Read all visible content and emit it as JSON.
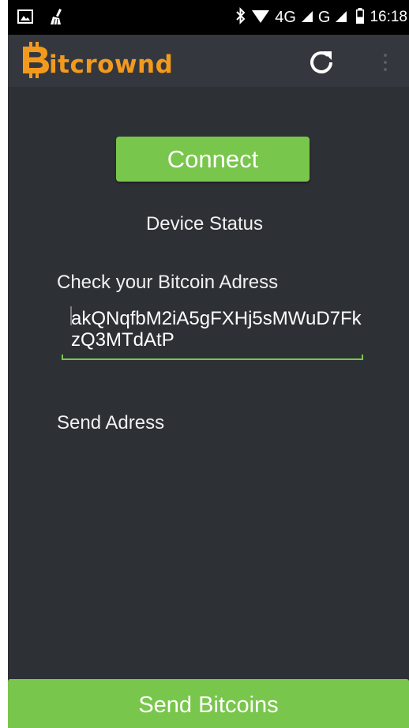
{
  "status_bar": {
    "network_4g": "4G",
    "network_g": "G",
    "time": "16:18",
    "icons": [
      "gallery-icon",
      "cleaner-icon",
      "bluetooth-icon",
      "wifi-icon",
      "signal-icon",
      "battery-icon"
    ]
  },
  "app_bar": {
    "logo_letter": "B",
    "logo_text": "itcrownd",
    "logo_color": "#f29a1e",
    "refresh_icon": "refresh-icon",
    "overflow_icon": "overflow-menu-icon"
  },
  "main": {
    "connect_label": "Connect",
    "device_status": "Device Status",
    "check_label": "Check your Bitcoin Adress",
    "address_value": "akQNqfbM2iA5gFXHj5sMWuD7FkzQ3MTdAtP",
    "send_address_label": "Send Adress"
  },
  "footer": {
    "send_label": "Send Bitcoins"
  },
  "colors": {
    "accent": "#79c64c",
    "background": "#2d3035",
    "app_bar": "#34383e"
  }
}
